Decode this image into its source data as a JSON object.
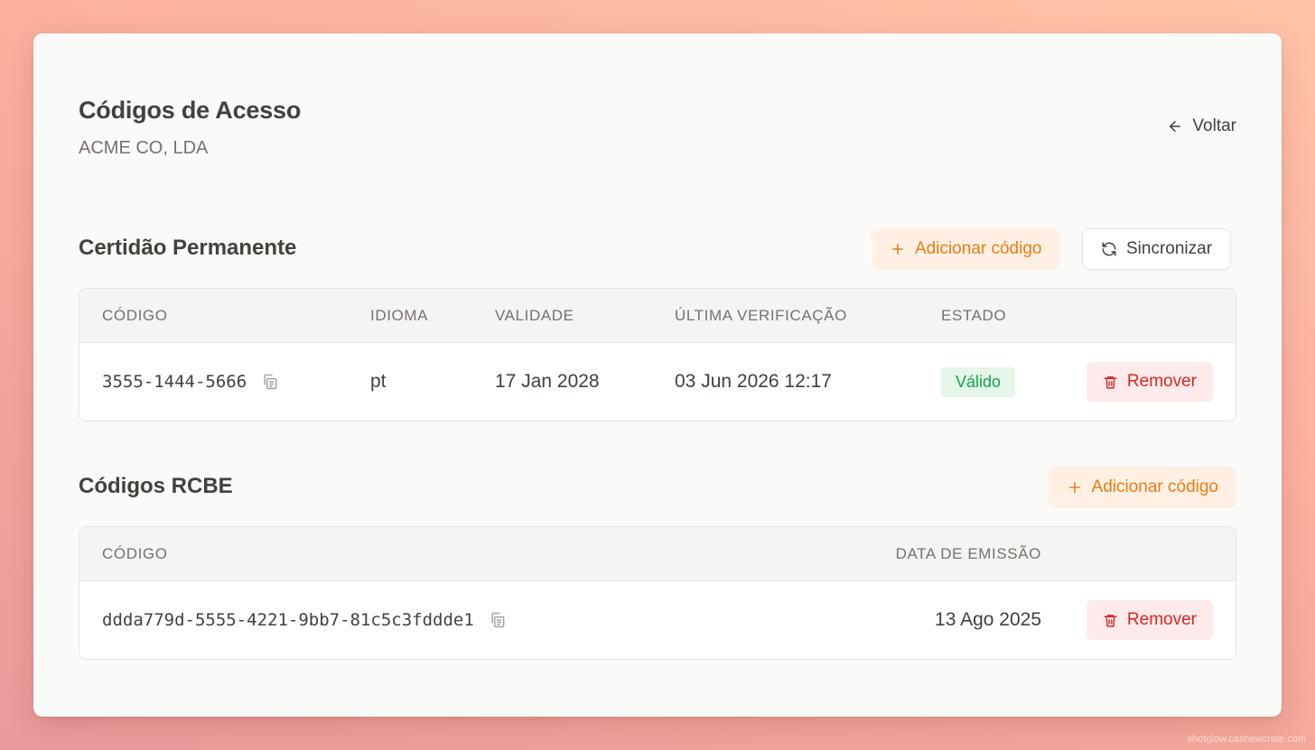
{
  "header": {
    "title": "Códigos de Acesso",
    "subtitle": "ACME CO, LDA",
    "back_label": "Voltar"
  },
  "certidao": {
    "title": "Certidão Permanente",
    "add_label": "Adicionar código",
    "sync_label": "Sincronizar",
    "columns": [
      "CÓDIGO",
      "IDIOMA",
      "VALIDADE",
      "ÚLTIMA VERIFICAÇÃO",
      "ESTADO"
    ],
    "rows": [
      {
        "code": "3555-1444-5666",
        "language": "pt",
        "validity": "17 Jan 2028",
        "last_check": "03 Jun 2026 12:17",
        "status": "Válido",
        "remove_label": "Remover"
      }
    ]
  },
  "rcbe": {
    "title": "Códigos RCBE",
    "add_label": "Adicionar código",
    "columns": [
      "CÓDIGO",
      "DATA DE EMISSÃO"
    ],
    "rows": [
      {
        "code": "ddda779d-5555-4221-9bb7-81c5c3fddde1",
        "issue_date": "13 Ago 2025",
        "remove_label": "Remover"
      }
    ]
  },
  "colors": {
    "accent_orange": "#ef7a12",
    "danger_red": "#dc2626",
    "success_green": "#16a34a"
  },
  "watermark": "shotglow.cashewcrate.com"
}
